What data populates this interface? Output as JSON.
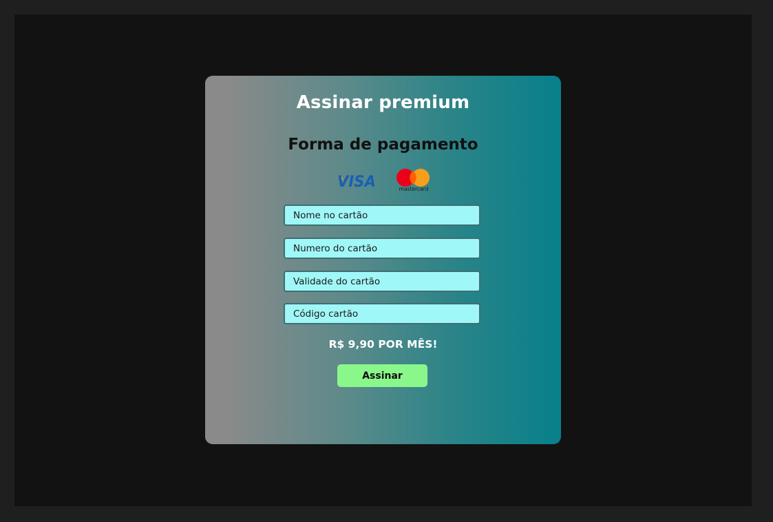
{
  "modal": {
    "title": "Assinar premium",
    "subtitle": "Forma de pagamento",
    "brands": [
      {
        "name": "VISA",
        "icon": "visa-logo"
      },
      {
        "name": "mastercard",
        "icon": "mastercard-logo"
      }
    ],
    "fields": [
      {
        "placeholder": "Nome no cartão",
        "value": ""
      },
      {
        "placeholder": "Numero do cartão",
        "value": ""
      },
      {
        "placeholder": "Validade do cartão",
        "value": ""
      },
      {
        "placeholder": "Código cartão",
        "value": ""
      }
    ],
    "price_text": "R$ 9,90 POR MÊS!",
    "submit_label": "Assinar"
  },
  "colors": {
    "page_background": "#1f1f1f",
    "screen_background": "#121212",
    "gradient_start": "#8a8a8a",
    "gradient_end": "#07808a",
    "input_background": "#a0f7f7",
    "button_background": "#8af78a",
    "visa_blue": "#1a5fb4",
    "visa_gold": "#f2a900",
    "mastercard_red": "#eb001b",
    "mastercard_orange": "#f79e1b"
  }
}
